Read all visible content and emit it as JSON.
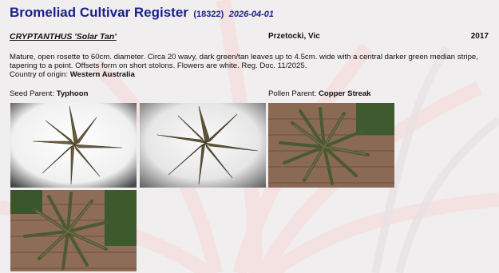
{
  "header": {
    "title": "Bromeliad Cultivar Register",
    "code": "(18322)",
    "date": "2026-04-01"
  },
  "entry": {
    "name": "CRYPTANTHUS 'Solar Tan'",
    "author": "Przetocki, Vic",
    "year": "2017",
    "description": "Mature, open rosette to 60cm. diameter. Circa 20 wavy, dark green/tan leaves up to 4.5cm. wide with a central darker green median stripe, tapering to a point. Offsets form on short stolons. Flowers are white. Reg. Doc. 11/2025.",
    "origin_label": "Country of origin:",
    "origin_value": "Western Australia",
    "seed_parent_label": "Seed Parent:",
    "seed_parent_value": "Typhoon",
    "pollen_parent_label": "Pollen Parent:",
    "pollen_parent_value": "Copper Streak"
  },
  "photos": [
    {
      "name": "plant-photo-1"
    },
    {
      "name": "plant-photo-2"
    },
    {
      "name": "plant-photo-3"
    },
    {
      "name": "plant-photo-4"
    }
  ],
  "colors": {
    "title": "#1a1f8c",
    "leaf_green": "#4f5a33",
    "leaf_tan": "#7a6a47"
  }
}
